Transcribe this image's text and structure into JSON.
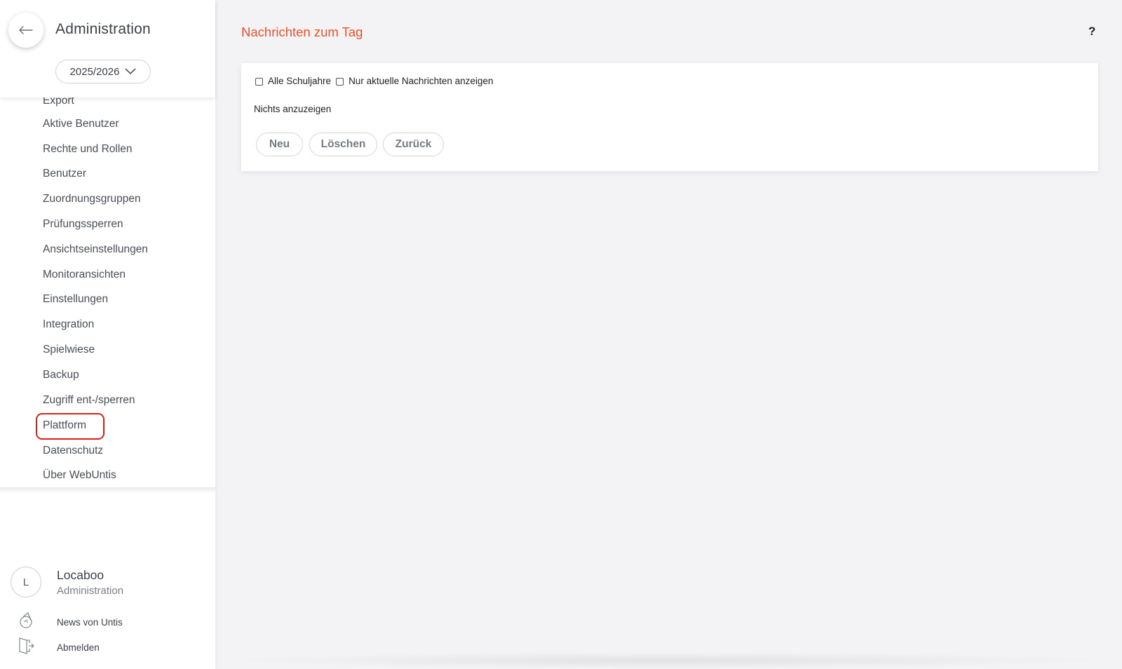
{
  "sidebar": {
    "back_icon": "arrow-left-icon",
    "title": "Administration",
    "year": "2025/2026",
    "nav_items": [
      "Export",
      "Aktive Benutzer",
      "Rechte und Rollen",
      "Benutzer",
      "Zuordnungsgruppen",
      "Prüfungssperren",
      "Ansichtseinstellungen",
      "Monitoransichten",
      "Einstellungen",
      "Integration",
      "Spielwiese",
      "Backup",
      "Zugriff ent-/sperren",
      "Plattform",
      "Datenschutz",
      "Über WebUntis"
    ],
    "highlighted_item": "Plattform",
    "highlight_color": "#d8231b",
    "user": {
      "avatar_letter": "L",
      "name": "Locaboo",
      "role": "Administration"
    },
    "links": {
      "news": "News von Untis",
      "logout": "Abmelden"
    }
  },
  "main": {
    "title": "Nachrichten zum Tag",
    "title_color": "#f0512a",
    "help": "?",
    "filters": {
      "all_years": "Alle Schuljahre",
      "current_only": "Nur aktuelle Nachrichten anzeigen"
    },
    "empty_text": "Nichts anzuzeigen",
    "buttons": {
      "new": "Neu",
      "delete": "Löschen",
      "back": "Zurück"
    }
  }
}
